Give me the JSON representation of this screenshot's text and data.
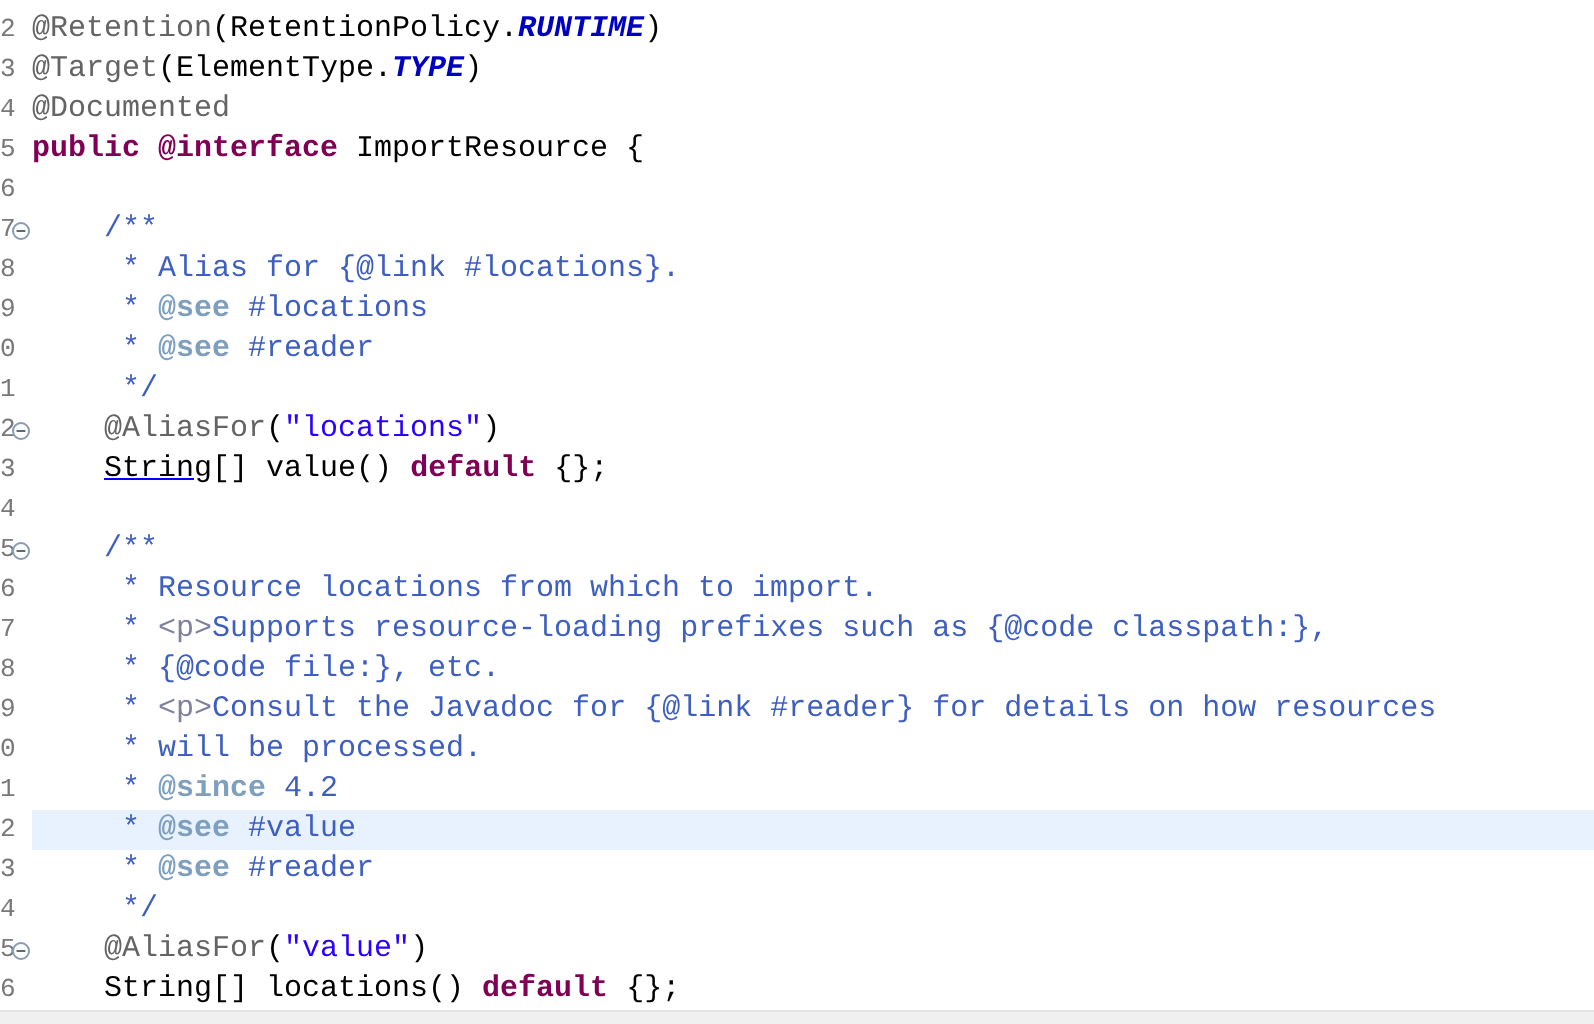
{
  "editor": {
    "lines": [
      {
        "number": "2",
        "foldable": false,
        "current": false,
        "tokens": [
          {
            "text": "@Retention",
            "kind": "anno"
          },
          {
            "text": "(RetentionPolicy.",
            "kind": "plain"
          },
          {
            "text": "RUNTIME",
            "kind": "const"
          },
          {
            "text": ")",
            "kind": "plain"
          }
        ]
      },
      {
        "number": "3",
        "foldable": false,
        "current": false,
        "tokens": [
          {
            "text": "@Target",
            "kind": "anno"
          },
          {
            "text": "(ElementType.",
            "kind": "plain"
          },
          {
            "text": "TYPE",
            "kind": "const"
          },
          {
            "text": ")",
            "kind": "plain"
          }
        ]
      },
      {
        "number": "4",
        "foldable": false,
        "current": false,
        "tokens": [
          {
            "text": "@Documented",
            "kind": "anno"
          }
        ]
      },
      {
        "number": "5",
        "foldable": false,
        "current": false,
        "tokens": [
          {
            "text": "public @interface",
            "kind": "keyword"
          },
          {
            "text": " ImportResource {",
            "kind": "plain"
          }
        ]
      },
      {
        "number": "6",
        "foldable": false,
        "current": false
      },
      {
        "number": "7",
        "foldable": true,
        "current": false,
        "tokens": [
          {
            "text": "    /**",
            "kind": "doc"
          }
        ]
      },
      {
        "number": "8",
        "foldable": false,
        "current": false,
        "tokens": [
          {
            "text": "     * Alias for {@link #locations}.",
            "kind": "doc"
          }
        ]
      },
      {
        "number": "9",
        "foldable": false,
        "current": false,
        "tokens": [
          {
            "text": "     * ",
            "kind": "doc"
          },
          {
            "text": "@see",
            "kind": "tag"
          },
          {
            "text": " #locations",
            "kind": "doc"
          }
        ]
      },
      {
        "number": "0",
        "foldable": false,
        "current": false,
        "tokens": [
          {
            "text": "     * ",
            "kind": "doc"
          },
          {
            "text": "@see",
            "kind": "tag"
          },
          {
            "text": " #reader",
            "kind": "doc"
          }
        ]
      },
      {
        "number": "1",
        "foldable": false,
        "current": false,
        "tokens": [
          {
            "text": "     */",
            "kind": "doc"
          }
        ]
      },
      {
        "number": "2",
        "foldable": true,
        "current": false,
        "tokens": [
          {
            "text": "    @AliasFor",
            "kind": "anno"
          },
          {
            "text": "(",
            "kind": "plain"
          },
          {
            "text": "\"locations\"",
            "kind": "string"
          },
          {
            "text": ")",
            "kind": "plain"
          }
        ]
      },
      {
        "number": "3",
        "foldable": false,
        "current": false,
        "tokens": [
          {
            "text": "    String",
            "kind": "link"
          },
          {
            "text": "[] value() ",
            "kind": "plain"
          },
          {
            "text": "default",
            "kind": "keyword"
          },
          {
            "text": " {};",
            "kind": "plain"
          }
        ]
      },
      {
        "number": "4",
        "foldable": false,
        "current": false
      },
      {
        "number": "5",
        "foldable": true,
        "current": false,
        "tokens": [
          {
            "text": "    /**",
            "kind": "doc"
          }
        ]
      },
      {
        "number": "6",
        "foldable": false,
        "current": false,
        "tokens": [
          {
            "text": "     * Resource locations from which to import.",
            "kind": "doc"
          }
        ]
      },
      {
        "number": "7",
        "foldable": false,
        "current": false,
        "tokens": [
          {
            "text": "     * ",
            "kind": "doc"
          },
          {
            "text": "<p>",
            "kind": "html"
          },
          {
            "text": "Supports resource-loading prefixes such as {@code classpath:},",
            "kind": "doc"
          }
        ]
      },
      {
        "number": "8",
        "foldable": false,
        "current": false,
        "tokens": [
          {
            "text": "     * {@code file:}, etc.",
            "kind": "doc"
          }
        ]
      },
      {
        "number": "9",
        "foldable": false,
        "current": false,
        "tokens": [
          {
            "text": "     * ",
            "kind": "doc"
          },
          {
            "text": "<p>",
            "kind": "html"
          },
          {
            "text": "Consult the Javadoc for {@link #reader} for details on how resources",
            "kind": "doc"
          }
        ]
      },
      {
        "number": "0",
        "foldable": false,
        "current": false,
        "tokens": [
          {
            "text": "     * will be processed.",
            "kind": "doc"
          }
        ]
      },
      {
        "number": "1",
        "foldable": false,
        "current": false,
        "tokens": [
          {
            "text": "     * ",
            "kind": "doc"
          },
          {
            "text": "@since",
            "kind": "tag"
          },
          {
            "text": " 4.2",
            "kind": "doc"
          }
        ]
      },
      {
        "number": "2",
        "foldable": false,
        "current": true,
        "tokens": [
          {
            "text": "     * ",
            "kind": "doc"
          },
          {
            "text": "@see",
            "kind": "tag"
          },
          {
            "text": " #value",
            "kind": "doc"
          }
        ]
      },
      {
        "number": "3",
        "foldable": false,
        "current": false,
        "tokens": [
          {
            "text": "     * ",
            "kind": "doc"
          },
          {
            "text": "@see",
            "kind": "tag"
          },
          {
            "text": " #reader",
            "kind": "doc"
          }
        ]
      },
      {
        "number": "4",
        "foldable": false,
        "current": false,
        "tokens": [
          {
            "text": "     */",
            "kind": "doc"
          }
        ]
      },
      {
        "number": "5",
        "foldable": true,
        "current": false,
        "tokens": [
          {
            "text": "    @AliasFor",
            "kind": "anno"
          },
          {
            "text": "(",
            "kind": "plain"
          },
          {
            "text": "\"value\"",
            "kind": "string"
          },
          {
            "text": ")",
            "kind": "plain"
          }
        ]
      },
      {
        "number": "6",
        "foldable": false,
        "current": false,
        "tokens": [
          {
            "text": "    String[] locations() ",
            "kind": "plain"
          },
          {
            "text": "default",
            "kind": "keyword"
          },
          {
            "text": " {};",
            "kind": "plain"
          }
        ]
      }
    ]
  }
}
